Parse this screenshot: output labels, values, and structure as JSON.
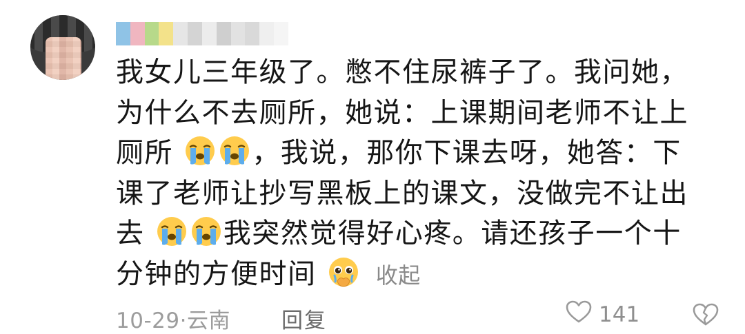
{
  "comment": {
    "lines": [
      "我女儿三年级了。憋不住尿裤子了。我问她，",
      "为什么不去厕所，她说：上课期间老师不让上",
      {
        "before": "厕所",
        "after": "，我说，那你下课去呀，她答：下"
      },
      "课了老师让抄写黑板上的课文，没做完不让出",
      {
        "before": "去",
        "after": "我突然觉得好心疼。请还孩子一个十"
      },
      {
        "before": "分钟的方便时间",
        "after": ""
      }
    ],
    "collapse_label": "收起",
    "emoji": {
      "crying": "loudly-crying-face",
      "pleading": "pleading-face-covering-mouth"
    }
  },
  "footer": {
    "date": "10-29",
    "separator": "·",
    "location": "云南",
    "reply_label": "回复",
    "like_count": "141"
  },
  "colors": {
    "text": "#161616",
    "secondary": "#9c9c9c",
    "reply": "#6b6b6b"
  }
}
